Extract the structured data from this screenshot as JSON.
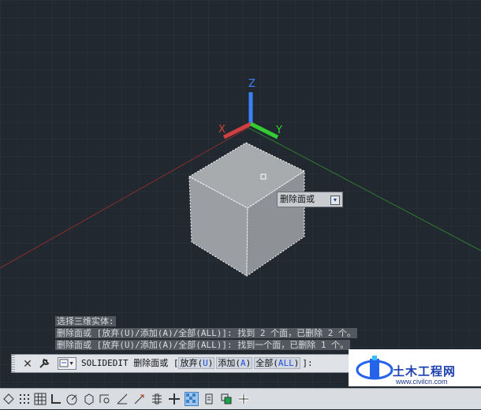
{
  "viewport": {
    "ucs_labels": {
      "z": "Z",
      "x": "X",
      "y": "Y"
    },
    "tooltip": {
      "text": "删除面或"
    }
  },
  "command_history": [
    "选择三维实体:",
    "删除面或 [放弃(U)/添加(A)/全部(ALL)]: 找到 2 个面，已删除 2 个。",
    "删除面或 [放弃(U)/添加(A)/全部(ALL)]: 找到一个面，已删除 1 个。"
  ],
  "command_line": {
    "command": "SOLIDEDIT 删除面或",
    "bracket_open": "[",
    "options": [
      {
        "label": "放弃(",
        "key": "U",
        "close": ")"
      },
      {
        "label": "添加(",
        "key": "A",
        "close": ")"
      },
      {
        "label": "全部(",
        "key": "ALL",
        "close": ")"
      }
    ],
    "bracket_close": "]:"
  },
  "watermark": {
    "title": "土木工程网",
    "url": "www.civilcn.com"
  },
  "colors": {
    "background": "#212830",
    "axis_x": "#d04040",
    "axis_y": "#33cc33",
    "axis_z": "#3b82f6",
    "cube_top": "#a8acaf",
    "cube_left": "#9a9ea2",
    "cube_right": "#8c9094"
  }
}
